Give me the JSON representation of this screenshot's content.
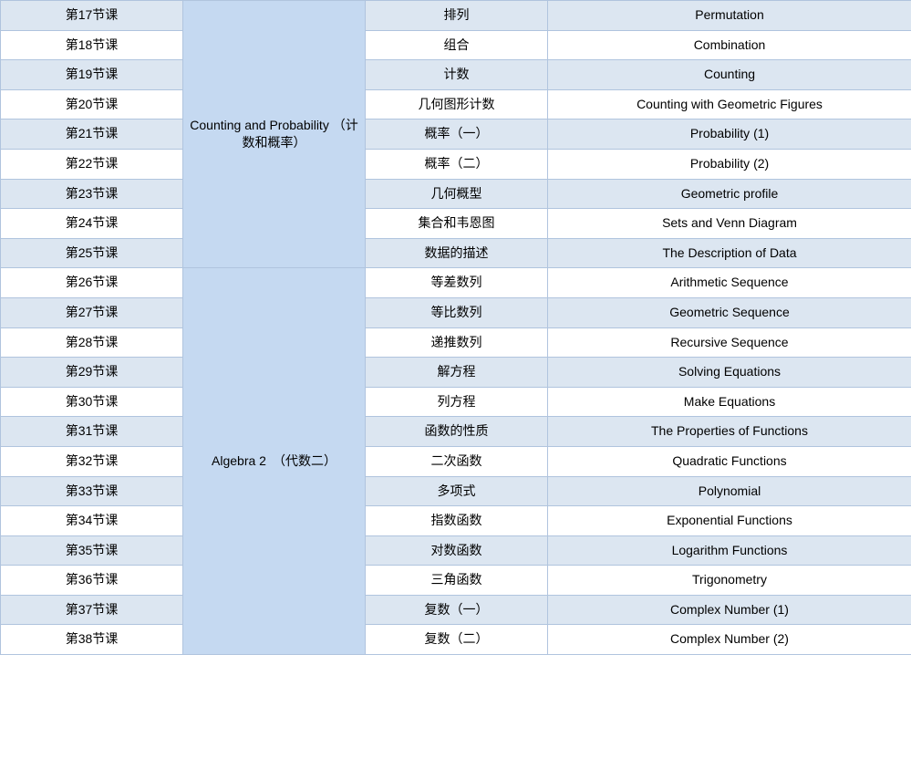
{
  "rows": [
    {
      "lesson": "第17节课",
      "category": null,
      "chinese": "排列",
      "english": "Permutation",
      "rowStyle": "row-light",
      "catRowspan": 9
    },
    {
      "lesson": "第18节课",
      "category": null,
      "chinese": "组合",
      "english": "Combination",
      "rowStyle": "row-white"
    },
    {
      "lesson": "第19节课",
      "category": null,
      "chinese": "计数",
      "english": "Counting",
      "rowStyle": "row-light"
    },
    {
      "lesson": "第20节课",
      "category": null,
      "chinese": "几何图形计数",
      "english": "Counting with Geometric Figures",
      "rowStyle": "row-white"
    },
    {
      "lesson": "第21节课",
      "category": null,
      "chinese": "概率（一）",
      "english": "Probability (1)",
      "rowStyle": "row-light"
    },
    {
      "lesson": "第22节课",
      "category": null,
      "chinese": "概率（二）",
      "english": "Probability (2)",
      "rowStyle": "row-white"
    },
    {
      "lesson": "第23节课",
      "category": null,
      "chinese": "几何概型",
      "english": "Geometric profile",
      "rowStyle": "row-light"
    },
    {
      "lesson": "第24节课",
      "category": null,
      "chinese": "集合和韦恩图",
      "english": "Sets and Venn Diagram",
      "rowStyle": "row-white"
    },
    {
      "lesson": "第25节课",
      "category": null,
      "chinese": "数据的描述",
      "english": "The Description of Data",
      "rowStyle": "row-light"
    },
    {
      "lesson": "第26节课",
      "category": null,
      "chinese": "等差数列",
      "english": "Arithmetic Sequence",
      "rowStyle": "row-white",
      "catRowspan": 13
    },
    {
      "lesson": "第27节课",
      "category": null,
      "chinese": "等比数列",
      "english": "Geometric Sequence",
      "rowStyle": "row-light"
    },
    {
      "lesson": "第28节课",
      "category": null,
      "chinese": "递推数列",
      "english": "Recursive Sequence",
      "rowStyle": "row-white"
    },
    {
      "lesson": "第29节课",
      "category": null,
      "chinese": "解方程",
      "english": "Solving Equations",
      "rowStyle": "row-light"
    },
    {
      "lesson": "第30节课",
      "category": null,
      "chinese": "列方程",
      "english": "Make Equations",
      "rowStyle": "row-white"
    },
    {
      "lesson": "第31节课",
      "category": null,
      "chinese": "函数的性质",
      "english": "The Properties of Functions",
      "rowStyle": "row-light"
    },
    {
      "lesson": "第32节课",
      "category": null,
      "chinese": "二次函数",
      "english": "Quadratic Functions",
      "rowStyle": "row-white"
    },
    {
      "lesson": "第33节课",
      "category": null,
      "chinese": "多项式",
      "english": "Polynomial",
      "rowStyle": "row-light"
    },
    {
      "lesson": "第34节课",
      "category": null,
      "chinese": "指数函数",
      "english": "Exponential Functions",
      "rowStyle": "row-white"
    },
    {
      "lesson": "第35节课",
      "category": null,
      "chinese": "对数函数",
      "english": "Logarithm Functions",
      "rowStyle": "row-light"
    },
    {
      "lesson": "第36节课",
      "category": null,
      "chinese": "三角函数",
      "english": "Trigonometry",
      "rowStyle": "row-white"
    },
    {
      "lesson": "第37节课",
      "category": null,
      "chinese": "复数（一）",
      "english": "Complex Number (1)",
      "rowStyle": "row-light"
    },
    {
      "lesson": "第38节课",
      "category": null,
      "chinese": "复数（二）",
      "english": "Complex Number (2)",
      "rowStyle": "row-white"
    }
  ],
  "categories": {
    "cat1": "Counting and Probability （计数和概率）",
    "cat2": "Algebra 2　（代数二）"
  }
}
